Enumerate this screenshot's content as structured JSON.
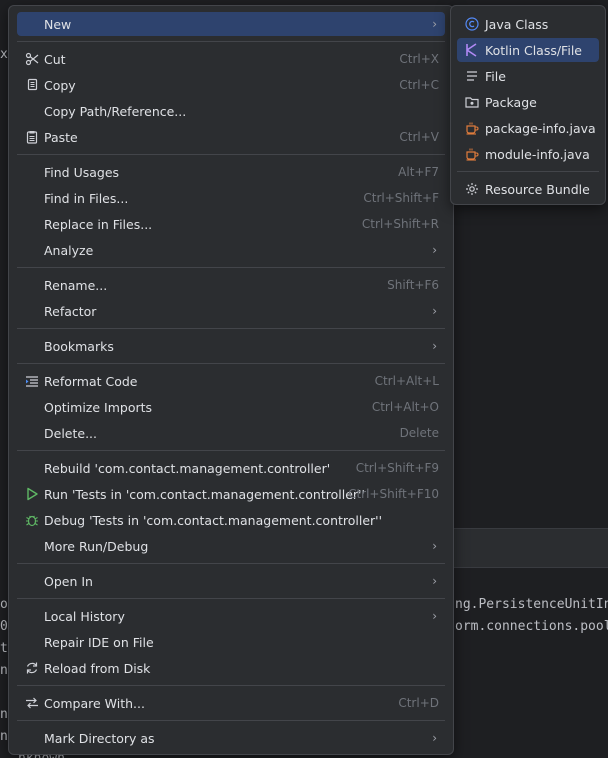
{
  "background": {
    "left_fragments": [
      "xt",
      "o",
      "0",
      "t",
      "n",
      "n",
      "n"
    ],
    "right_fragments": [
      "ng.PersistenceUnitIn",
      "orm.connections.pool"
    ],
    "bottom_text": "nknown"
  },
  "main_menu": {
    "items": [
      {
        "label": "New",
        "shortcut": "",
        "submenu": true,
        "selected": true
      },
      {
        "label": "Cut",
        "shortcut": "Ctrl+X",
        "icon": "scissors-icon"
      },
      {
        "label": "Copy",
        "shortcut": "Ctrl+C",
        "icon": "copy-icon"
      },
      {
        "label": "Copy Path/Reference...",
        "shortcut": ""
      },
      {
        "label": "Paste",
        "shortcut": "Ctrl+V",
        "icon": "clipboard-icon"
      },
      {
        "label": "Find Usages",
        "shortcut": "Alt+F7"
      },
      {
        "label": "Find in Files...",
        "shortcut": "Ctrl+Shift+F"
      },
      {
        "label": "Replace in Files...",
        "shortcut": "Ctrl+Shift+R"
      },
      {
        "label": "Analyze",
        "submenu": true
      },
      {
        "label": "Rename...",
        "shortcut": "Shift+F6"
      },
      {
        "label": "Refactor",
        "submenu": true
      },
      {
        "label": "Bookmarks",
        "submenu": true
      },
      {
        "label": "Reformat Code",
        "shortcut": "Ctrl+Alt+L",
        "icon": "reformat-icon"
      },
      {
        "label": "Optimize Imports",
        "shortcut": "Ctrl+Alt+O"
      },
      {
        "label": "Delete...",
        "shortcut": "Delete"
      },
      {
        "label": "Rebuild 'com.contact.management.controller'",
        "shortcut": "Ctrl+Shift+F9"
      },
      {
        "label": "Run 'Tests in 'com.contact.management.controller''",
        "shortcut": "Ctrl+Shift+F10",
        "icon": "run-icon"
      },
      {
        "label": "Debug 'Tests in 'com.contact.management.controller''",
        "shortcut": "",
        "icon": "debug-icon"
      },
      {
        "label": "More Run/Debug",
        "submenu": true
      },
      {
        "label": "Open In",
        "submenu": true
      },
      {
        "label": "Local History",
        "submenu": true
      },
      {
        "label": "Repair IDE on File",
        "shortcut": ""
      },
      {
        "label": "Reload from Disk",
        "shortcut": "",
        "icon": "reload-icon"
      },
      {
        "label": "Compare With...",
        "shortcut": "Ctrl+D",
        "icon": "compare-icon"
      },
      {
        "label": "Mark Directory as",
        "submenu": true
      }
    ]
  },
  "sub_menu": {
    "items": [
      {
        "label": "Java Class",
        "icon": "java-class-icon"
      },
      {
        "label": "Kotlin Class/File",
        "icon": "kotlin-icon",
        "selected": true
      },
      {
        "label": "File",
        "icon": "file-icon"
      },
      {
        "label": "Package",
        "icon": "package-icon"
      },
      {
        "label": "package-info.java",
        "icon": "java-file-icon"
      },
      {
        "label": "module-info.java",
        "icon": "java-file-icon"
      },
      {
        "label": "Resource Bundle",
        "icon": "resource-bundle-icon"
      }
    ]
  },
  "colors": {
    "menu_bg": "#2b2d30",
    "selection": "#2e436e",
    "shortcut_text": "#6f737a",
    "run_green": "#5fb865",
    "java_orange": "#e07c3c",
    "kotlin_purple": "#9a6cf2"
  }
}
